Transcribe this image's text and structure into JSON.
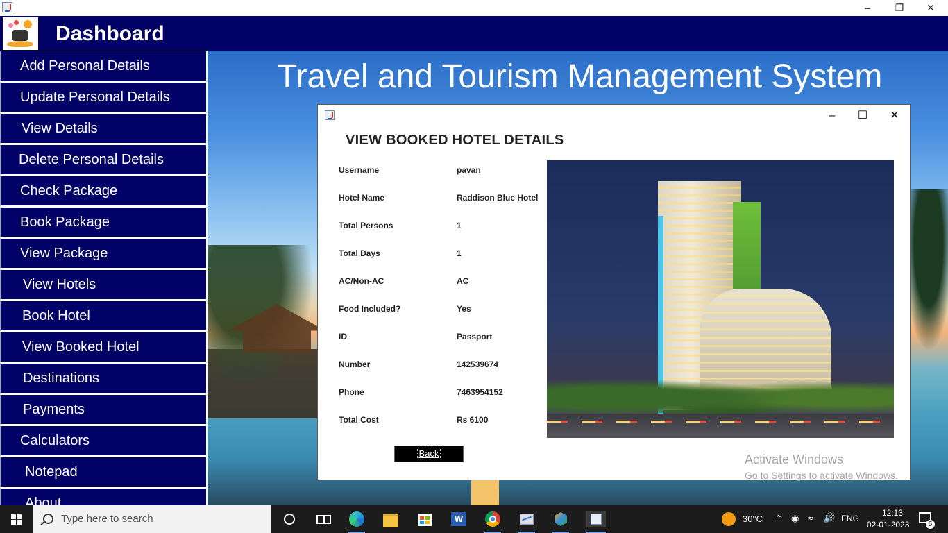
{
  "header": {
    "title": "Dashboard"
  },
  "background": {
    "title": "Travel and Tourism Management System"
  },
  "sidebar": {
    "items": [
      {
        "label": "Add Personal Details"
      },
      {
        "label": "Update Personal Details"
      },
      {
        "label": "View Details"
      },
      {
        "label": "Delete Personal Details"
      },
      {
        "label": "Check Package"
      },
      {
        "label": "Book Package"
      },
      {
        "label": "View Package"
      },
      {
        "label": "View Hotels"
      },
      {
        "label": "Book Hotel"
      },
      {
        "label": "View Booked Hotel"
      },
      {
        "label": "Destinations"
      },
      {
        "label": "Payments"
      },
      {
        "label": "Calculators"
      },
      {
        "label": "Notepad"
      },
      {
        "label": "About"
      }
    ]
  },
  "dialog": {
    "heading": "VIEW BOOKED HOTEL DETAILS",
    "fields": [
      {
        "label": "Username",
        "value": "pavan"
      },
      {
        "label": "Hotel Name",
        "value": "Raddison Blue Hotel"
      },
      {
        "label": "Total Persons",
        "value": "1"
      },
      {
        "label": "Total Days",
        "value": "1"
      },
      {
        "label": "AC/Non-AC",
        "value": "AC"
      },
      {
        "label": "Food Included?",
        "value": "Yes"
      },
      {
        "label": "ID",
        "value": "Passport"
      },
      {
        "label": "Number",
        "value": "142539674"
      },
      {
        "label": "Phone",
        "value": "7463954152"
      },
      {
        "label": "Total Cost",
        "value": "Rs 6100"
      }
    ],
    "back_label": "Back"
  },
  "watermark": {
    "line1": "Activate Windows",
    "line2": "Go to Settings to activate Windows."
  },
  "taskbar": {
    "search_placeholder": "Type here to search",
    "weather": "30°C",
    "language": "ENG",
    "time": "12:13",
    "date": "02-01-2023",
    "notification_count": "5"
  },
  "colors": {
    "navy": "#000066",
    "taskbar": "#1c1c1c"
  }
}
